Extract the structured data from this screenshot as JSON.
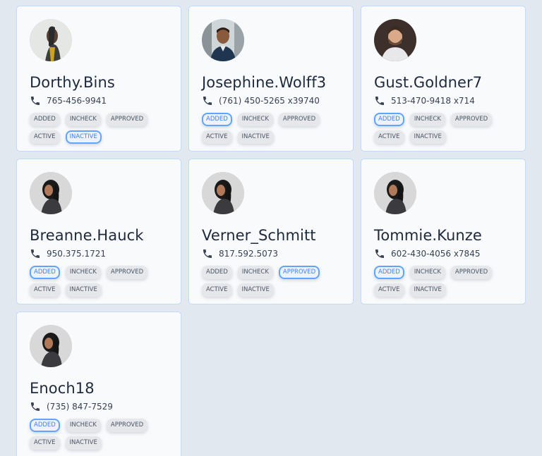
{
  "tag_labels": [
    "ADDED",
    "INCHECK",
    "APPROVED",
    "ACTIVE",
    "INACTIVE"
  ],
  "accent_color": "#60a5fa",
  "users": [
    {
      "name": "Dorthy.Bins",
      "phone": "765-456-9941",
      "selected_tag": "INACTIVE",
      "avatar": "woman-profile-dark"
    },
    {
      "name": "Josephine.Wolff3",
      "phone": "(761) 450-5265 x39740",
      "selected_tag": "ADDED",
      "avatar": "man-suit"
    },
    {
      "name": "Gust.Goldner7",
      "phone": "513-470-9418 x714",
      "selected_tag": "ADDED",
      "avatar": "man-beard"
    },
    {
      "name": "Breanne.Hauck",
      "phone": "950.375.1721",
      "selected_tag": "ADDED",
      "avatar": "woman-curly"
    },
    {
      "name": "Verner_Schmitt",
      "phone": "817.592.5073",
      "selected_tag": "APPROVED",
      "avatar": "woman-curly"
    },
    {
      "name": "Tommie.Kunze",
      "phone": "602-430-4056 x7845",
      "selected_tag": "ADDED",
      "avatar": "woman-curly"
    },
    {
      "name": "Enoch18",
      "phone": "(735) 847-7529",
      "selected_tag": "ADDED",
      "avatar": "woman-curly"
    }
  ]
}
